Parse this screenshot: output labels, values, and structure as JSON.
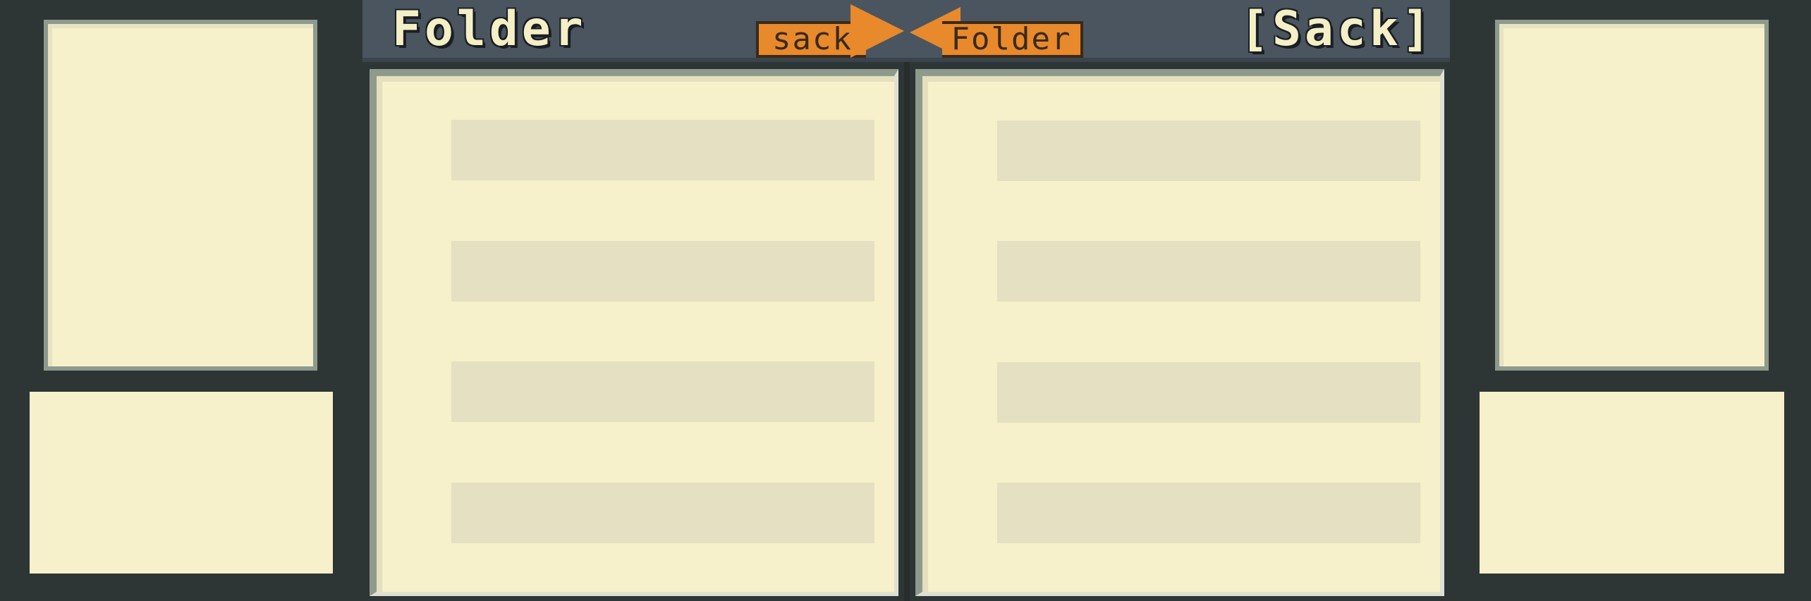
{
  "header": {
    "title_left": "Folder",
    "title_right": "[Sack]",
    "tab_sack": "sack",
    "tab_folder": "Folder"
  },
  "colors": {
    "background": "#2e3535",
    "header": "#4a5560",
    "panel": "#f6f0cb",
    "slot": "#e6e0c2",
    "tab": "#e8892c",
    "title_text": "#f4efc6"
  },
  "icons": {
    "arrow_right": "triangle-right-icon",
    "arrow_left": "triangle-left-icon"
  }
}
